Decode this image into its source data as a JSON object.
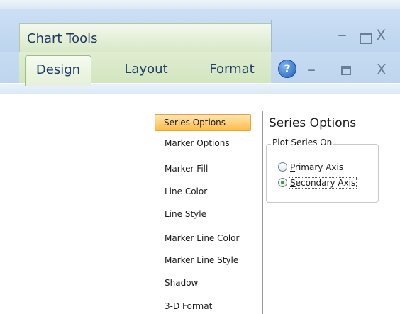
{
  "ribbon": {
    "context_title": "Chart Tools",
    "tabs": [
      {
        "label": "Design",
        "selected": true
      },
      {
        "label": "Layout",
        "selected": false
      },
      {
        "label": "Format",
        "selected": false
      }
    ],
    "window_controls": {
      "minimize": "–",
      "close": "X"
    },
    "help_glyph": "?"
  },
  "dialog": {
    "nav_items": [
      {
        "label": "Series Options",
        "selected": true
      },
      {
        "label": "Marker Options",
        "selected": false
      },
      {
        "label": "Marker Fill",
        "selected": false
      },
      {
        "label": "Line Color",
        "selected": false
      },
      {
        "label": "Line Style",
        "selected": false
      },
      {
        "label": "Marker Line Color",
        "selected": false
      },
      {
        "label": "Marker Line Style",
        "selected": false
      },
      {
        "label": "Shadow",
        "selected": false
      },
      {
        "label": "3-D Format",
        "selected": false
      }
    ],
    "section_title": "Series Options",
    "group_label": "Plot Series On",
    "radio_options": [
      {
        "label_first": "P",
        "label_rest": "rimary Axis",
        "checked": false
      },
      {
        "label_first": "S",
        "label_rest": "econdary Axis",
        "checked": true
      }
    ]
  }
}
